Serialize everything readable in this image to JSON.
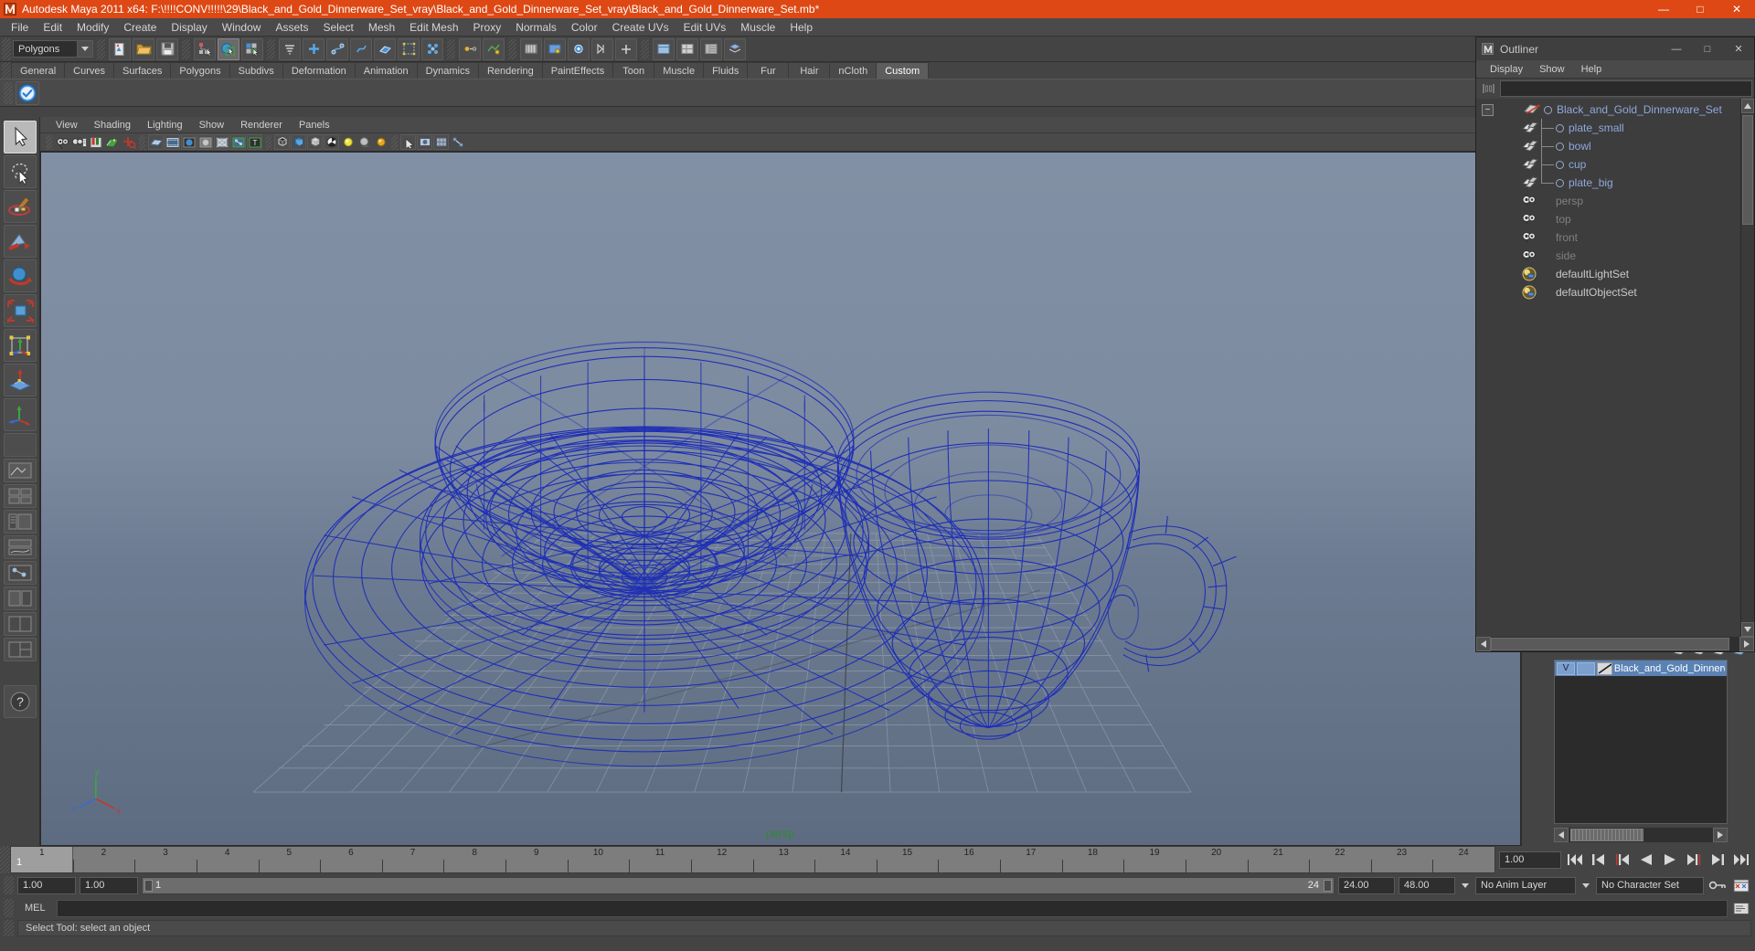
{
  "window": {
    "title": "Autodesk Maya 2011 x64: F:\\!!!!CONV!!!!!\\29\\Black_and_Gold_Dinnerware_Set_vray\\Black_and_Gold_Dinnerware_Set_vray\\Black_and_Gold_Dinnerware_Set.mb*",
    "app_icon": "maya-icon",
    "minimize": "—",
    "maximize": "□",
    "close": "✕",
    "accent_color": "#dd4814"
  },
  "menubar": {
    "items": [
      {
        "label": "File"
      },
      {
        "label": "Edit"
      },
      {
        "label": "Modify"
      },
      {
        "label": "Create"
      },
      {
        "label": "Display"
      },
      {
        "label": "Window"
      },
      {
        "label": "Assets"
      },
      {
        "label": "Select"
      },
      {
        "label": "Mesh"
      },
      {
        "label": "Edit Mesh"
      },
      {
        "label": "Proxy"
      },
      {
        "label": "Normals"
      },
      {
        "label": "Color"
      },
      {
        "label": "Create UVs"
      },
      {
        "label": "Edit UVs"
      },
      {
        "label": "Muscle"
      },
      {
        "label": "Help"
      }
    ]
  },
  "statusline": {
    "mode_menu_value": "Polygons",
    "icons": [
      "new-scene-icon",
      "open-scene-icon",
      "save-scene-icon",
      "select-by-hierarchy-icon",
      "select-by-object-icon",
      "select-by-component-icon",
      "snap-list-icon",
      "snap-to-grid-icon",
      "snap-to-curve-icon",
      "snap-to-point-icon",
      "snap-to-plane-icon",
      "snap-to-view-plane-icon",
      "make-live-icon",
      "history-icon",
      "render-icon",
      "ipr-render-icon",
      "render-settings-icon",
      "toggle-sidebar-icon",
      "attribute-editor-icon",
      "tool-settings-icon",
      "channel-box-icon"
    ]
  },
  "shelf": {
    "tabs": [
      {
        "label": "General",
        "active": false
      },
      {
        "label": "Curves",
        "active": false
      },
      {
        "label": "Surfaces",
        "active": false
      },
      {
        "label": "Polygons",
        "active": false
      },
      {
        "label": "Subdivs",
        "active": false
      },
      {
        "label": "Deformation",
        "active": false
      },
      {
        "label": "Animation",
        "active": false
      },
      {
        "label": "Dynamics",
        "active": false
      },
      {
        "label": "Rendering",
        "active": false
      },
      {
        "label": "PaintEffects",
        "active": false
      },
      {
        "label": "Toon",
        "active": false
      },
      {
        "label": "Muscle",
        "active": false
      },
      {
        "label": "Fluids",
        "active": false
      },
      {
        "label": "Fur",
        "active": false
      },
      {
        "label": "Hair",
        "active": false
      },
      {
        "label": "nCloth",
        "active": false
      },
      {
        "label": "Custom",
        "active": true
      }
    ],
    "buttons": [
      "vray-checkmark-icon"
    ]
  },
  "toolbox": {
    "tools": [
      {
        "name": "select-tool",
        "selected": true
      },
      {
        "name": "lasso-select-tool",
        "selected": false
      },
      {
        "name": "paint-select-tool",
        "selected": false
      },
      {
        "name": "move-tool",
        "selected": false
      },
      {
        "name": "rotate-tool",
        "selected": false
      },
      {
        "name": "scale-tool",
        "selected": false
      },
      {
        "name": "universal-manipulator-tool",
        "selected": false
      },
      {
        "name": "soft-modification-tool",
        "selected": false
      },
      {
        "name": "last-tool-used",
        "selected": false
      }
    ],
    "layouts": [
      "single-perspective-layout",
      "four-view-layout",
      "outliner-persp-layout",
      "persp-graph-layout",
      "hypershade-persp-layout",
      "persp-side-layout",
      "two-pane-layout",
      "three-pane-layout",
      "help-icon"
    ]
  },
  "viewport": {
    "menus": [
      {
        "label": "View"
      },
      {
        "label": "Shading"
      },
      {
        "label": "Lighting"
      },
      {
        "label": "Show"
      },
      {
        "label": "Renderer"
      },
      {
        "label": "Panels"
      }
    ],
    "toolbar_icons": [
      "select-camera-icon",
      "camera-attributes-icon",
      "bookmarks-icon",
      "image-plane-icon",
      "two-d-pan-zoom-icon",
      "grid-toggle-icon",
      "film-gate-icon",
      "resolution-gate-icon",
      "gate-mask-icon",
      "xray-icon",
      "xray-joints-icon",
      "texture-icon",
      "wireframe-icon",
      "smooth-shade-all-icon",
      "smooth-shade-selected-icon",
      "hardware-texturing-icon",
      "lighting-icon",
      "shadows-icon",
      "high-quality-render-icon",
      "exposure-icon",
      "gamma-icon",
      "isolate-select-icon",
      "snapshot-icon",
      "panel-tear-icon"
    ],
    "camera_label": "persp",
    "axis_labels": {
      "x": "x",
      "y": "y",
      "z": "z"
    },
    "background_top_color": "#8290a5",
    "background_bottom_color": "#5e6c81",
    "wireframe_color": "#1f2fb5",
    "grid_color": "#8e9aab",
    "scene_objects": [
      "plate_big",
      "plate_small",
      "cup",
      "bowl"
    ]
  },
  "outliner": {
    "title": "Outliner",
    "window_icon": "maya-small-icon",
    "minimize": "—",
    "maximize": "□",
    "close": "✕",
    "menus": [
      {
        "label": "Display"
      },
      {
        "label": "Show"
      },
      {
        "label": "Help"
      }
    ],
    "search_placeholder": "",
    "search_value": "",
    "search_icon": "outliner-filter-icon",
    "expander": "−",
    "items": [
      {
        "label": "Black_and_Gold_Dinnerware_Set",
        "icon": "set-node-icon",
        "style": "blue",
        "depth": 0,
        "expandable": true
      },
      {
        "label": "plate_small",
        "icon": "mesh-node-icon",
        "style": "blue",
        "depth": 1,
        "expandable": false
      },
      {
        "label": "bowl",
        "icon": "mesh-node-icon",
        "style": "blue",
        "depth": 1,
        "expandable": false
      },
      {
        "label": "cup",
        "icon": "mesh-node-icon",
        "style": "blue",
        "depth": 1,
        "expandable": false
      },
      {
        "label": "plate_big",
        "icon": "mesh-node-icon",
        "style": "blue",
        "depth": 1,
        "expandable": false
      },
      {
        "label": "persp",
        "icon": "camera-node-icon",
        "style": "dim",
        "depth": 1,
        "expandable": false
      },
      {
        "label": "top",
        "icon": "camera-node-icon",
        "style": "dim",
        "depth": 1,
        "expandable": false
      },
      {
        "label": "front",
        "icon": "camera-node-icon",
        "style": "dim",
        "depth": 1,
        "expandable": false
      },
      {
        "label": "side",
        "icon": "camera-node-icon",
        "style": "dim",
        "depth": 1,
        "expandable": false
      },
      {
        "label": "defaultLightSet",
        "icon": "set-icon",
        "style": "norm",
        "depth": 1,
        "expandable": false
      },
      {
        "label": "defaultObjectSet",
        "icon": "set-icon",
        "style": "norm",
        "depth": 1,
        "expandable": false
      }
    ]
  },
  "layers": {
    "toolbar_icons": [
      "new-layer-icon",
      "new-layer-selected-icon",
      "layer-up-icon",
      "layer-down-icon"
    ],
    "rows": [
      {
        "visibility": "V",
        "playback": "",
        "color_swatch": "diagonal-swatch",
        "name": "Black_and_Gold_Dinnerwa",
        "selected": true
      }
    ]
  },
  "timeslider": {
    "current_frame": "1",
    "frame_labels": [
      "1",
      "2",
      "3",
      "4",
      "5",
      "6",
      "7",
      "8",
      "9",
      "10",
      "11",
      "12",
      "13",
      "14",
      "15",
      "16",
      "17",
      "18",
      "19",
      "20",
      "21",
      "22",
      "23",
      "24"
    ],
    "start": 1,
    "end": 24,
    "playback_speed_field": "1.00",
    "transport": [
      {
        "name": "go-to-start-button",
        "glyph": "rewind-start"
      },
      {
        "name": "step-back-frame-button",
        "glyph": "step-back"
      },
      {
        "name": "step-back-key-button",
        "glyph": "key-back"
      },
      {
        "name": "play-backwards-button",
        "glyph": "play-back"
      },
      {
        "name": "play-forwards-button",
        "glyph": "play-fwd"
      },
      {
        "name": "step-forward-key-button",
        "glyph": "key-fwd"
      },
      {
        "name": "step-forward-frame-button",
        "glyph": "step-fwd"
      },
      {
        "name": "go-to-end-button",
        "glyph": "rewind-end"
      }
    ]
  },
  "rangeslider": {
    "anim_start": "1.00",
    "range_start": "1.00",
    "bar_start_label": "1",
    "bar_end_label": "24",
    "range_end": "24.00",
    "anim_end": "48.00",
    "anim_layer": "No Anim Layer",
    "character_set": "No Character Set",
    "key-icon": "auto-key-icon",
    "prefs-icon": "animation-preferences-icon"
  },
  "commandline": {
    "language_label": "MEL",
    "input_value": "",
    "input_placeholder": "",
    "script-editor-icon": "script-editor-icon"
  },
  "helpline": {
    "message": "Select Tool: select an object"
  }
}
